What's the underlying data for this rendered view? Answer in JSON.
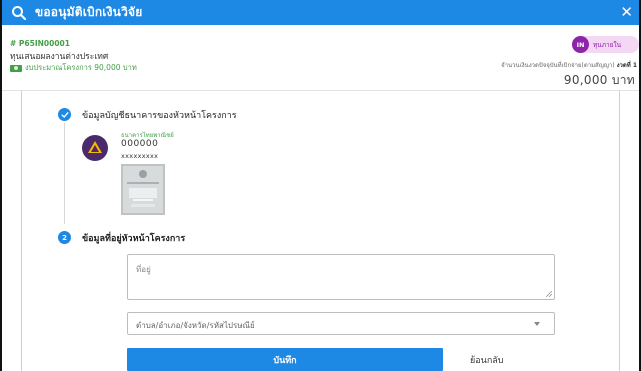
{
  "window": {
    "title": "ขออนุมัติเบิกเงินวิจัย",
    "close_glyph": "✕"
  },
  "project": {
    "code": "# P65IN00001",
    "name": "ทุนเสนอผลงานต่างประเทศ",
    "budget_label": "งบประมาณโครงการ 90,000 บาท",
    "fund_badge_short": "IN",
    "fund_badge_label": "ทุนภายใน",
    "installment_label": "จำนวนเงินงวดปัจจุบันที่เบิกจ่าย(ตามสัญญา)",
    "installment_no": "งวดที่ 1",
    "installment_amount": "90,000 บาท"
  },
  "step1": {
    "title": "ข้อมูลบัญชีธนาคารของหัวหน้าโครงการ",
    "bank_name": "ธนาคารไทยพาณิชย์",
    "account_number": "000000",
    "account_owner": "xxxxxxxxx"
  },
  "step2": {
    "number": "2",
    "title": "ข้อมูลที่อยู่หัวหน้าโครงการ",
    "address_placeholder": "ที่อยู่",
    "region_placeholder": "ตำบล/อำเภอ/จังหวัด/รหัสไปรษณีย์"
  },
  "actions": {
    "save_label": "บันทึก",
    "back_label": "ย้อนกลับ"
  },
  "colors": {
    "primary": "#1e88e5",
    "success": "#43a047",
    "badge_purple": "#8e24aa",
    "bank_logo": "#4a2a6b"
  },
  "icons": {
    "title": "search-icon",
    "close": "close-icon",
    "step_done": "check-icon",
    "budget": "money-icon",
    "select": "chevron-down-icon"
  }
}
